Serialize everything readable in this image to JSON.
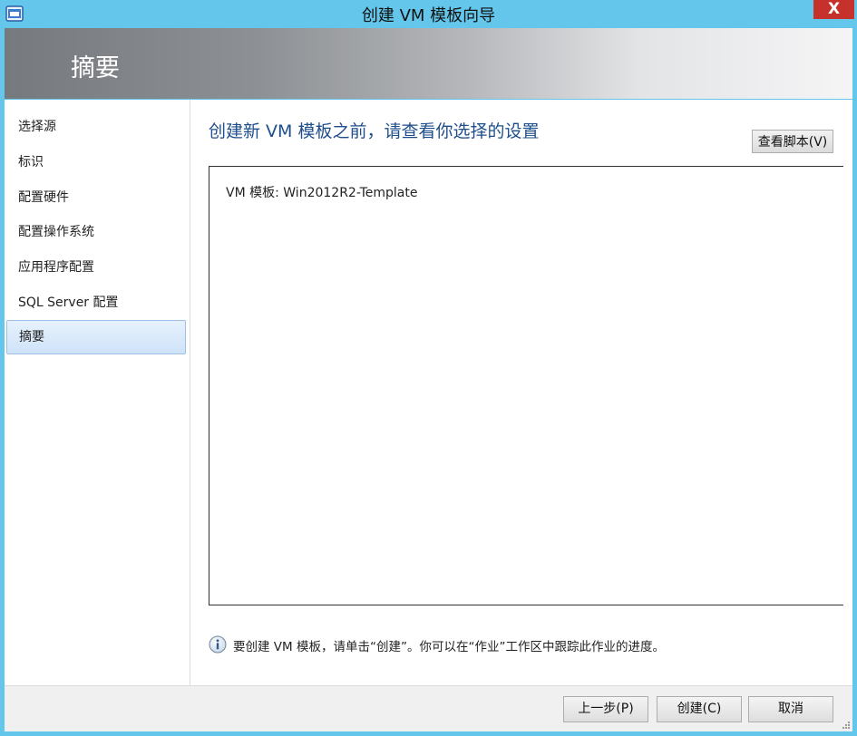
{
  "window": {
    "title": "创建 VM 模板向导",
    "close_label": "X"
  },
  "banner": {
    "title": "摘要"
  },
  "sidebar": {
    "items": [
      {
        "label": "选择源"
      },
      {
        "label": "标识"
      },
      {
        "label": "配置硬件"
      },
      {
        "label": "配置操作系统"
      },
      {
        "label": "应用程序配置"
      },
      {
        "label": "SQL Server 配置"
      },
      {
        "label": "摘要",
        "active": true
      }
    ]
  },
  "main": {
    "heading": "创建新 VM 模板之前，请查看你选择的设置",
    "view_script_label": "查看脚本(V)",
    "summary_line": "VM 模板: Win2012R2-Template",
    "info_text": "要创建 VM 模板，请单击“创建”。你可以在“作业”工作区中跟踪此作业的进度。"
  },
  "footer": {
    "back_label": "上一步(P)",
    "create_label": "创建(C)",
    "cancel_label": "取消"
  },
  "icons": {
    "app": "app-window-icon",
    "info": "info-icon",
    "close": "close-icon",
    "grip": "resize-grip-icon"
  },
  "colors": {
    "titlebar": "#63c6ea",
    "heading": "#1e4e8c",
    "close": "#c7312b",
    "active_item": "#cfe3f9"
  }
}
